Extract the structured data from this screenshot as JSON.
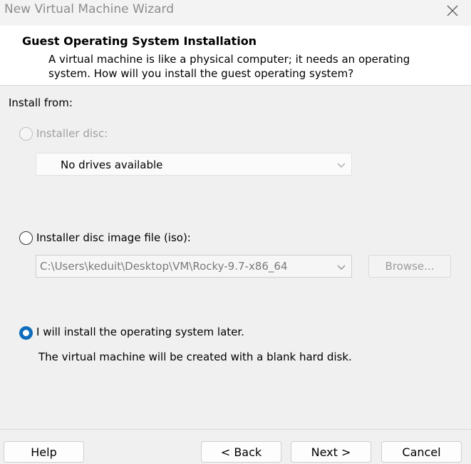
{
  "window": {
    "title": "New Virtual Machine Wizard"
  },
  "header": {
    "title": "Guest Operating System Installation",
    "description": "A virtual machine is like a physical computer; it needs an operating system. How will you install the guest operating system?"
  },
  "install_from": {
    "label": "Install from:",
    "disc": {
      "label": "Installer disc:",
      "selected": false,
      "enabled": false,
      "drive_value": "No drives available"
    },
    "iso": {
      "label": "Installer disc image file (iso):",
      "selected": false,
      "path_value": "C:\\Users\\keduit\\Desktop\\VM\\Rocky-9.7-x86_64",
      "browse_label": "Browse..."
    },
    "later": {
      "label": "I will install the operating system later.",
      "selected": true,
      "description": "The virtual machine will be created with a blank hard disk."
    }
  },
  "footer": {
    "help": "Help",
    "back": "< Back",
    "next": "Next >",
    "cancel": "Cancel"
  },
  "colors": {
    "accent": "#0f6cbd",
    "header_bg": "#ffffff",
    "body_bg": "#f0f0f0"
  }
}
